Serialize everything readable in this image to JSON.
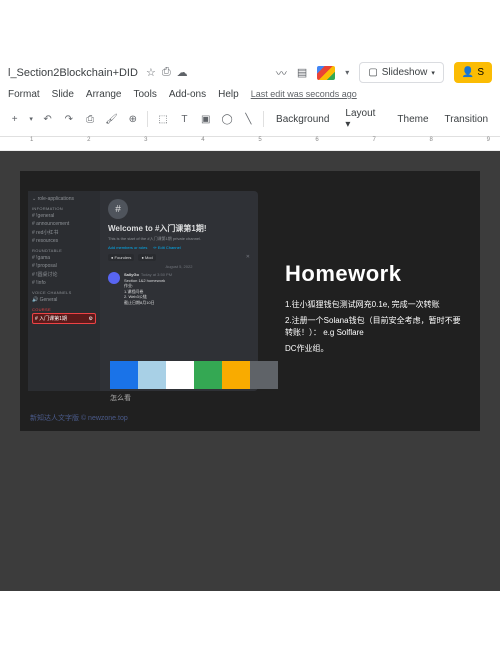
{
  "doc": {
    "title": "l_Section2Blockchain+DID"
  },
  "menu": {
    "format": "Format",
    "slide": "Slide",
    "arrange": "Arrange",
    "tools": "Tools",
    "addons": "Add-ons",
    "help": "Help",
    "last_edit": "Last edit was seconds ago"
  },
  "toolbar": {
    "background": "Background",
    "layout": "Layout",
    "theme": "Theme",
    "transition": "Transition"
  },
  "buttons": {
    "slideshow": "Slideshow",
    "share": "S"
  },
  "ruler": {
    "marks": [
      "1",
      "2",
      "3",
      "4",
      "5",
      "6",
      "7",
      "8",
      "9"
    ]
  },
  "discord": {
    "categories": {
      "roleapp": "⌄ role-applications",
      "info": "INFORMATION",
      "roundtable": "ROUNDTABLE",
      "voice": "VOICE CHANNELS",
      "course": "COURSE"
    },
    "channels": {
      "general1": "# !general",
      "announcement": "# announcement",
      "redbook": "# red小红书",
      "resources": "# resources",
      "gama": "# !gama",
      "proposal": "# !proposal",
      "roundtable_ch": "# !圆桌讨论",
      "info_ch": "# !info",
      "voice_general": "🔊 General",
      "course_active": "# 入门课第1期"
    },
    "welcome": "Welcome to #入门课第1期!",
    "subtitle": "This is the start of the #入门课第1期 private channel.",
    "add_members": "Add members or roles",
    "edit_channel": "✏ Edit Channel",
    "badge_founders": "● Founders",
    "badge_mod": "● Mod",
    "date": "August 5, 2022",
    "msg_user": "SallyGo",
    "msg_time": "Today at 3:50 PM",
    "msg_l1": "Section 1&2 homework",
    "msg_l2": "作业:",
    "msg_l3": "1.课程问卷",
    "msg_l4": "2. Web3公链",
    "msg_l5": "截止日期8月10日",
    "channel_icon": "⚙"
  },
  "palette": {
    "colors": [
      "#1a73e8",
      "#a8d0e6",
      "#ffffff",
      "#34a853",
      "#f9ab00",
      "#5f6368"
    ],
    "label": "怎么看"
  },
  "homework": {
    "title": "Homework",
    "item1": "1.往小狐狸钱包测试网充0.1e, 完成一次转账",
    "item2": "2.注册一个Solana钱包（目前安全考虑，暂时不要转账！）： e.g Solflare",
    "item3": "DC作业组。"
  },
  "bottom_link": "新知达人文字版 © newzone.top"
}
